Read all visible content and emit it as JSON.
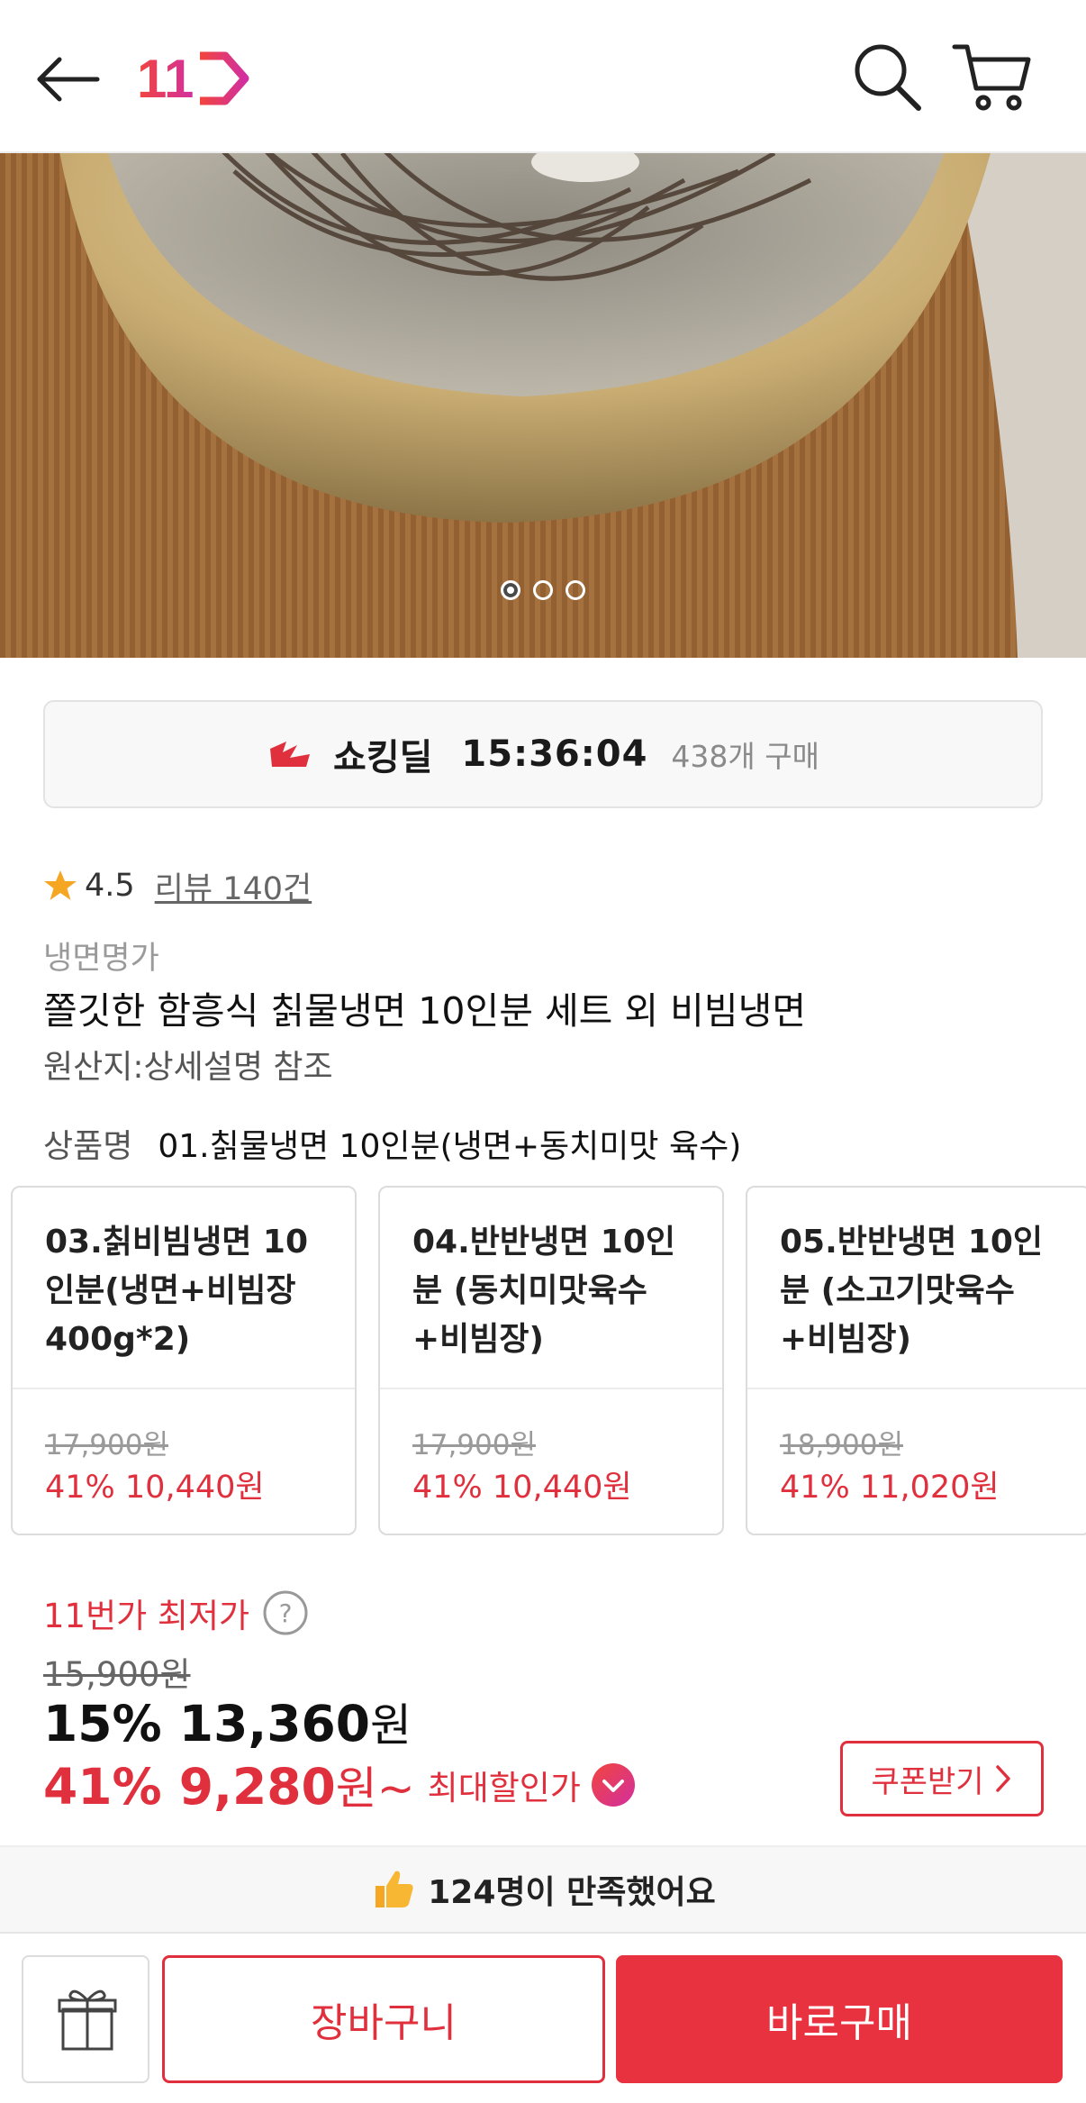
{
  "header": {
    "logo_text": "11",
    "icons": [
      "back-arrow-icon",
      "search-icon",
      "cart-icon"
    ]
  },
  "hero": {
    "image_desc": "naengmyeon noodles in brass bowl on bamboo mat",
    "carousel_total": 3,
    "carousel_active": 1
  },
  "deal": {
    "title": "쇼킹딜",
    "timer": "15:36:04",
    "purchase_count": "438개 구매"
  },
  "rating": {
    "score": "4.5",
    "reviews": "리뷰 140건"
  },
  "product": {
    "brand": "냉면명가",
    "title": "쫄깃한 함흥식 칡물냉면 10인분 세트 외 비빔냉면",
    "origin": "원산지:상세설명 참조",
    "option_label": "상품명",
    "option_value": "01.칡물냉면 10인분(냉면+동치미맛 육수)"
  },
  "options": [
    {
      "name": "03.칡비빔냉면 10인분(냉면+비빔장 400g*2)",
      "original": "17,900원",
      "sale": "41% 10,440원"
    },
    {
      "name": "04.반반냉면 10인분 (동치미맛육수+비빔장)",
      "original": "17,900원",
      "sale": "41% 10,440원"
    },
    {
      "name": "05.반반냉면 10인분 (소고기맛육수+비빔장)",
      "original": "18,900원",
      "sale": "41% 11,020원"
    }
  ],
  "price": {
    "lowest_label": "11번가 최저가",
    "original": "15,900원",
    "main_value": "15% 13,360",
    "main_unit": "원",
    "max_value": "41% 9,280",
    "max_unit": "원~",
    "max_label": "최대할인가",
    "coupon_label": "쿠폰받기"
  },
  "satisfaction": {
    "text": "124명이 만족했어요"
  },
  "actions": {
    "cart_label": "장바구니",
    "buy_label": "바로구매"
  },
  "colors": {
    "accent": "#e0303d",
    "buy_button": "#e8323f",
    "star": "#f5a623"
  }
}
